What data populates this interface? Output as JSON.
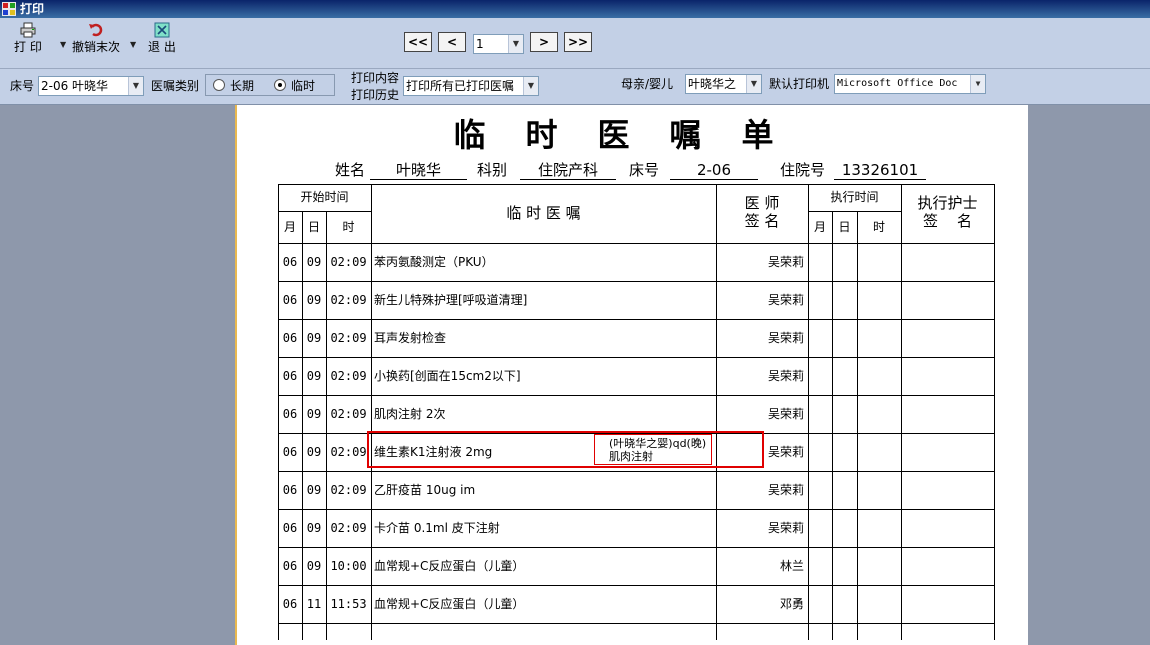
{
  "window": {
    "title": "打印"
  },
  "toolbar": {
    "print_label": "打 印",
    "undo_label": "撤销末次",
    "exit_label": "退 出",
    "nav_first": "<<",
    "nav_prev": "<",
    "page_value": "1",
    "nav_next": ">",
    "nav_last": ">>"
  },
  "filters": {
    "bed_label": "床号",
    "bed_value": "2-06 叶晓华",
    "order_type_label": "医嘱类别",
    "order_type_options": [
      "长期",
      "临时"
    ],
    "order_type_selected": "临时",
    "print_content_label": "打印内容",
    "print_history_label": "打印历史",
    "print_content_value": "打印所有已打印医嘱",
    "mother_baby_label": "母亲/婴儿",
    "mother_baby_value": "叶晓华之",
    "printer_label": "默认打印机",
    "printer_value": "Microsoft Office Doc"
  },
  "document": {
    "title": "临时医嘱单",
    "name_label": "姓名",
    "name_value": "叶晓华",
    "dept_label": "科别",
    "dept_value": "住院产科",
    "bed_label": "床号",
    "bed_value": "2-06",
    "admission_label": "住院号",
    "admission_value": "13326101",
    "headers": {
      "start_time": "开始时间",
      "month": "月",
      "day": "日",
      "hour": "时",
      "order": "临 时 医 嘱",
      "doctor_sign_1": "医 师",
      "doctor_sign_2": "签 名",
      "exec_time": "执行时间",
      "exec_month": "月",
      "exec_day": "日",
      "exec_hour": "时",
      "nurse_sign_1": "执行护士",
      "nurse_sign_2": "签    名"
    },
    "rows": [
      {
        "month": "06",
        "day": "09",
        "time": "02:09",
        "order": "苯丙氨酸测定（PKU）",
        "doctor": "吴荣莉"
      },
      {
        "month": "06",
        "day": "09",
        "time": "02:09",
        "order": "新生儿特殊护理[呼吸道清理]",
        "doctor": "吴荣莉"
      },
      {
        "month": "06",
        "day": "09",
        "time": "02:09",
        "order": "耳声发射检查",
        "doctor": "吴荣莉"
      },
      {
        "month": "06",
        "day": "09",
        "time": "02:09",
        "order": "小换药[创面在15cm2以下]",
        "doctor": "吴荣莉"
      },
      {
        "month": "06",
        "day": "09",
        "time": "02:09",
        "order": "肌肉注射 2次",
        "doctor": "吴荣莉"
      },
      {
        "month": "06",
        "day": "09",
        "time": "02:09",
        "order": "维生素K1注射液 2mg",
        "doctor": "吴荣莉"
      },
      {
        "month": "06",
        "day": "09",
        "time": "02:09",
        "order": "乙肝疫苗 10ug im",
        "doctor": "吴荣莉"
      },
      {
        "month": "06",
        "day": "09",
        "time": "02:09",
        "order": "卡介苗 0.1ml 皮下注射",
        "doctor": "吴荣莉"
      },
      {
        "month": "06",
        "day": "09",
        "time": "10:00",
        "order": "血常规+C反应蛋白（儿童）",
        "doctor": "林兰"
      },
      {
        "month": "06",
        "day": "11",
        "time": "11:53",
        "order": "血常规+C反应蛋白（儿童）",
        "doctor": "邓勇"
      }
    ],
    "tooltip_line1": "(叶晓华之婴)qd(晚)",
    "tooltip_line2": "肌肉注射"
  }
}
